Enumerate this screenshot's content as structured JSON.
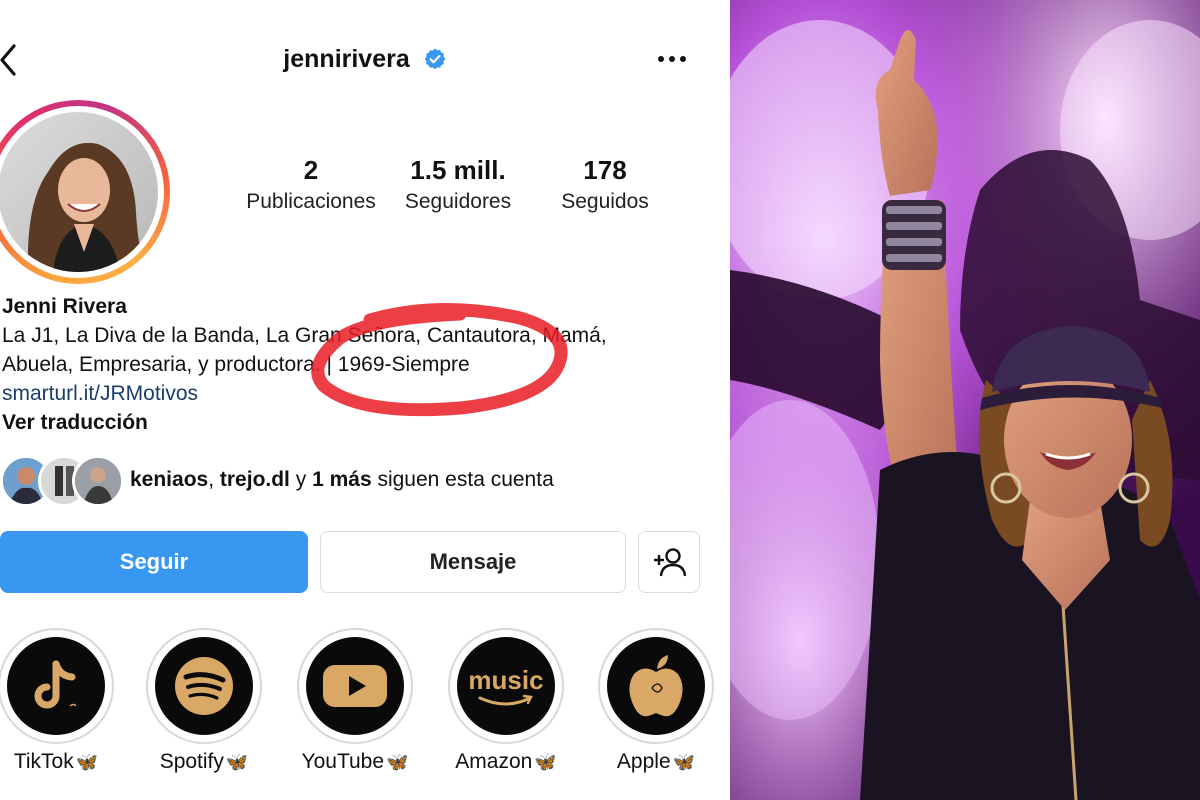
{
  "profile": {
    "username": "jennirivera",
    "verified": true,
    "stats": [
      {
        "value": "2",
        "label": "Publicaciones"
      },
      {
        "value": "1.5 mill.",
        "label": "Seguidores"
      },
      {
        "value": "178",
        "label": "Seguidos"
      }
    ],
    "name": "Jenni Rivera",
    "bio_line1": "La J1, La Diva de la Banda, La Gran Señora, Cantautora, Mamá,",
    "bio_line2": "Abuela, Empresaria, y productora. | 1969-Siempre",
    "link": "smarturl.it/JRMotivos",
    "translate": "Ver traducción",
    "followed_by": {
      "name1": "keniaos",
      "sep": ", ",
      "name2": "trejo.dl",
      "and": " y ",
      "more": "1 más",
      "suffix": " siguen esta cuenta"
    }
  },
  "actions": {
    "follow": "Seguir",
    "message": "Mensaje"
  },
  "highlights": [
    {
      "label": "TikTok",
      "emoji": "🦋",
      "icon": "tiktok-icon"
    },
    {
      "label": "Spotify",
      "emoji": "🦋",
      "icon": "spotify-icon"
    },
    {
      "label": "YouTube",
      "emoji": "🦋",
      "icon": "youtube-icon"
    },
    {
      "label": "Amazon",
      "emoji": "🦋",
      "icon": "amazon-music-icon"
    },
    {
      "label": "Apple",
      "emoji": "🦋",
      "icon": "apple-icon"
    }
  ],
  "highlight_texts": {
    "amazon_logo": "music"
  },
  "colors": {
    "follow_button": "#3897f0",
    "link": "#1b3d6b",
    "verified": "#3897f0",
    "highlight_gold": "#d9a866",
    "annotation_red": "#e81c24"
  }
}
